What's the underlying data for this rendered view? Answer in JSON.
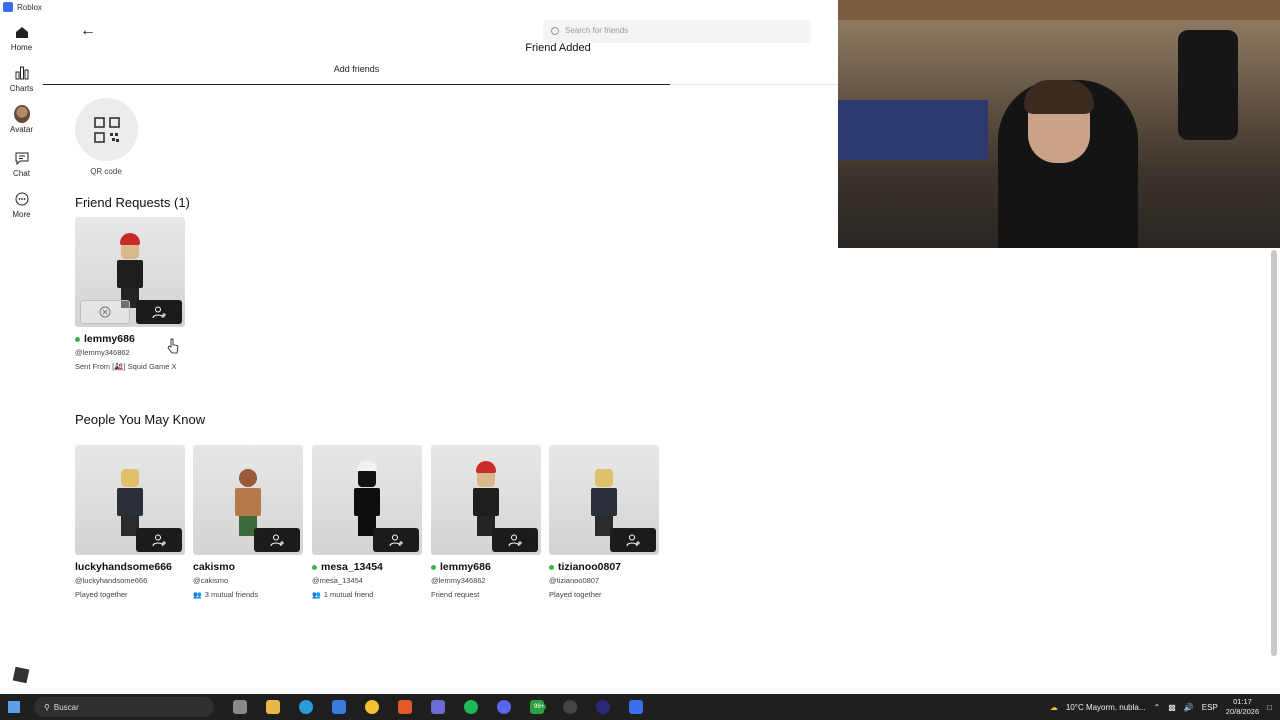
{
  "window": {
    "title": "Roblox"
  },
  "sidebar": {
    "items": [
      {
        "label": "Home",
        "icon": "home-icon"
      },
      {
        "label": "Charts",
        "icon": "charts-icon"
      },
      {
        "label": "Avatar",
        "icon": "avatar-icon"
      },
      {
        "label": "Chat",
        "icon": "chat-icon"
      },
      {
        "label": "More",
        "icon": "more-icon"
      }
    ]
  },
  "header": {
    "search_placeholder": "Search for friends",
    "toast": "Friend Added",
    "tab_label": "Add friends"
  },
  "qr": {
    "label": "QR code"
  },
  "friend_requests": {
    "title": "Friend Requests (1)",
    "items": [
      {
        "name": "lemmy686",
        "handle": "@lemmy346862",
        "meta": "Sent From [🎎] Squid Game X",
        "online": true
      }
    ]
  },
  "people_you_may_know": {
    "title": "People You May Know",
    "items": [
      {
        "name": "luckyhandsome666",
        "handle": "@luckyhandsome666",
        "meta": "Played together",
        "online": false
      },
      {
        "name": "cakismo",
        "handle": "@cakismo",
        "meta": "3 mutual friends",
        "online": false,
        "mutual": true
      },
      {
        "name": "mesa_13454",
        "handle": "@mesa_13454",
        "meta": "1 mutual friend",
        "online": true,
        "mutual": true
      },
      {
        "name": "lemmy686",
        "handle": "@lemmy346862",
        "meta": "Friend request",
        "online": true
      },
      {
        "name": "tizianoo0807",
        "handle": "@tizianoo0807",
        "meta": "Played together",
        "online": true
      }
    ]
  },
  "taskbar": {
    "search_text": "Buscar",
    "weather": "10°C Mayorm. nubla...",
    "language": "ESP",
    "time": "01:17",
    "date": "20/8/2026",
    "badge": "99+"
  },
  "colors": {
    "online": "#3cb54a",
    "accent_dark": "#1b1b1b"
  }
}
